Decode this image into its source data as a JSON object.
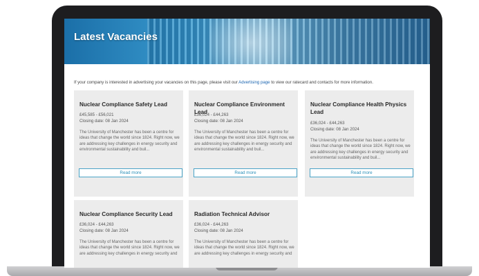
{
  "hero": {
    "title": "Latest Vacancies"
  },
  "intro": {
    "before": "If your company is interested in advertising your vacancies on this page, please visit our ",
    "link": "Advertising page",
    "after": " to view our ratecard and contacts for more information."
  },
  "cards": [
    {
      "title": "Nuclear Compliance Safety Lead",
      "salary": "£45,585 - £56,021",
      "closing": "Closing date: 08 Jan 2024",
      "description": "The University of Manchester has been a centre for ideas that change the world since 1824. Right now, we are addressing key challenges in energy security and environmental sustainability and buil...",
      "button": "Read more"
    },
    {
      "title": "Nuclear Compliance Environment Lead",
      "salary": "£36,024 - £44,263",
      "closing": "Closing date: 08 Jan 2024",
      "description": "The University of Manchester has been a centre for ideas that change the world since 1824. Right now, we are addressing key challenges in energy security and environmental sustainability and buil...",
      "button": "Read more"
    },
    {
      "title": "Nuclear Compliance Health Physics Lead",
      "salary": "£36,024 - £44,263",
      "closing": "Closing date: 08 Jan 2024",
      "description": "The University of Manchester has been a centre for ideas that change the world since 1824. Right now, we are addressing key challenges in energy security and environmental sustainability and buil...",
      "button": "Read more"
    },
    {
      "title": "Nuclear Compliance Security Lead",
      "salary": "£36,024 - £44,263",
      "closing": "Closing date: 08 Jan 2024",
      "description": "The University of Manchester has been a centre for ideas that change the world since 1824. Right now, we are addressing key challenges in energy security and",
      "button": ""
    },
    {
      "title": "Radiation Technical Advisor",
      "salary": "£36,024 - £44,263",
      "closing": "Closing date: 08 Jan 2024",
      "description": "The University of Manchester has been a centre for ideas that change the world since 1824. Right now, we are addressing key challenges in energy security and",
      "button": ""
    }
  ]
}
